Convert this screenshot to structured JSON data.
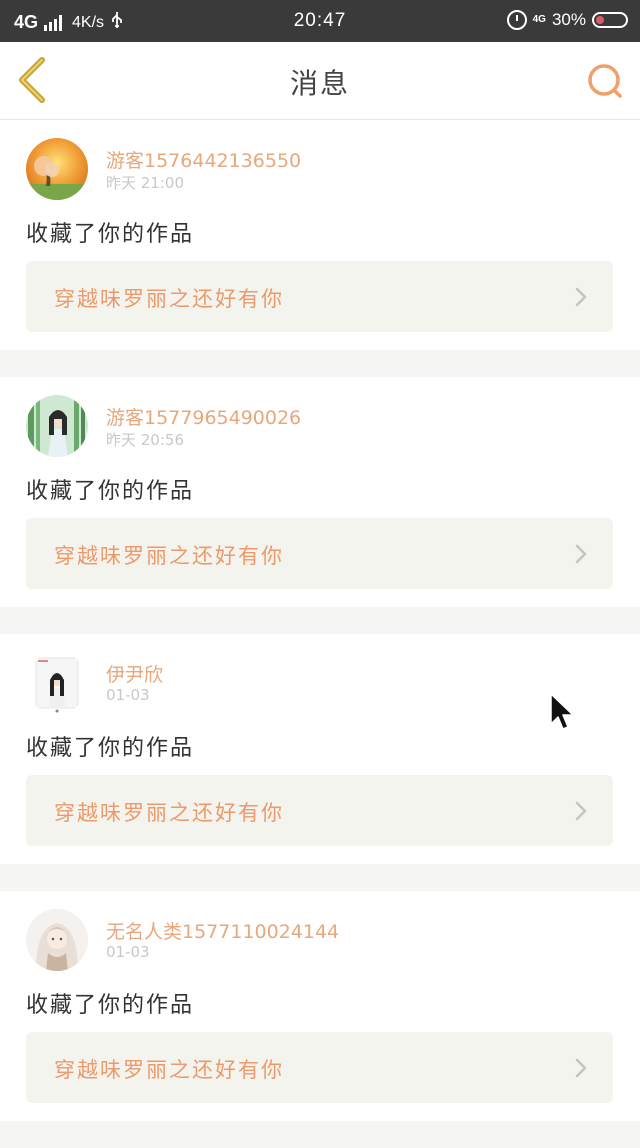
{
  "status_bar": {
    "network": "4G",
    "speed": "4K/s",
    "time": "20:47",
    "secondary_network": "4G",
    "battery_percent": "30%",
    "battery_level": 0.3,
    "signal_bars": 4
  },
  "header": {
    "title": "消息",
    "back_icon": "chevron-left-icon",
    "search_icon": "search-icon"
  },
  "colors": {
    "accent": "#ec9a6c",
    "back_icon": "#c9a431",
    "search_icon": "#f0a06a"
  },
  "messages": [
    {
      "username": "游客1576442136550",
      "timestamp": "昨天 21:00",
      "action": "收藏了你的作品",
      "work_title": "穿越味罗丽之还好有你"
    },
    {
      "username": "游客1577965490026",
      "timestamp": "昨天 20:56",
      "action": "收藏了你的作品",
      "work_title": "穿越味罗丽之还好有你"
    },
    {
      "username": "伊尹欣",
      "timestamp": "01-03",
      "action": "收藏了你的作品",
      "work_title": "穿越味罗丽之还好有你"
    },
    {
      "username": "无名人类1577110024144",
      "timestamp": "01-03",
      "action": "收藏了你的作品",
      "work_title": "穿越味罗丽之还好有你"
    }
  ]
}
